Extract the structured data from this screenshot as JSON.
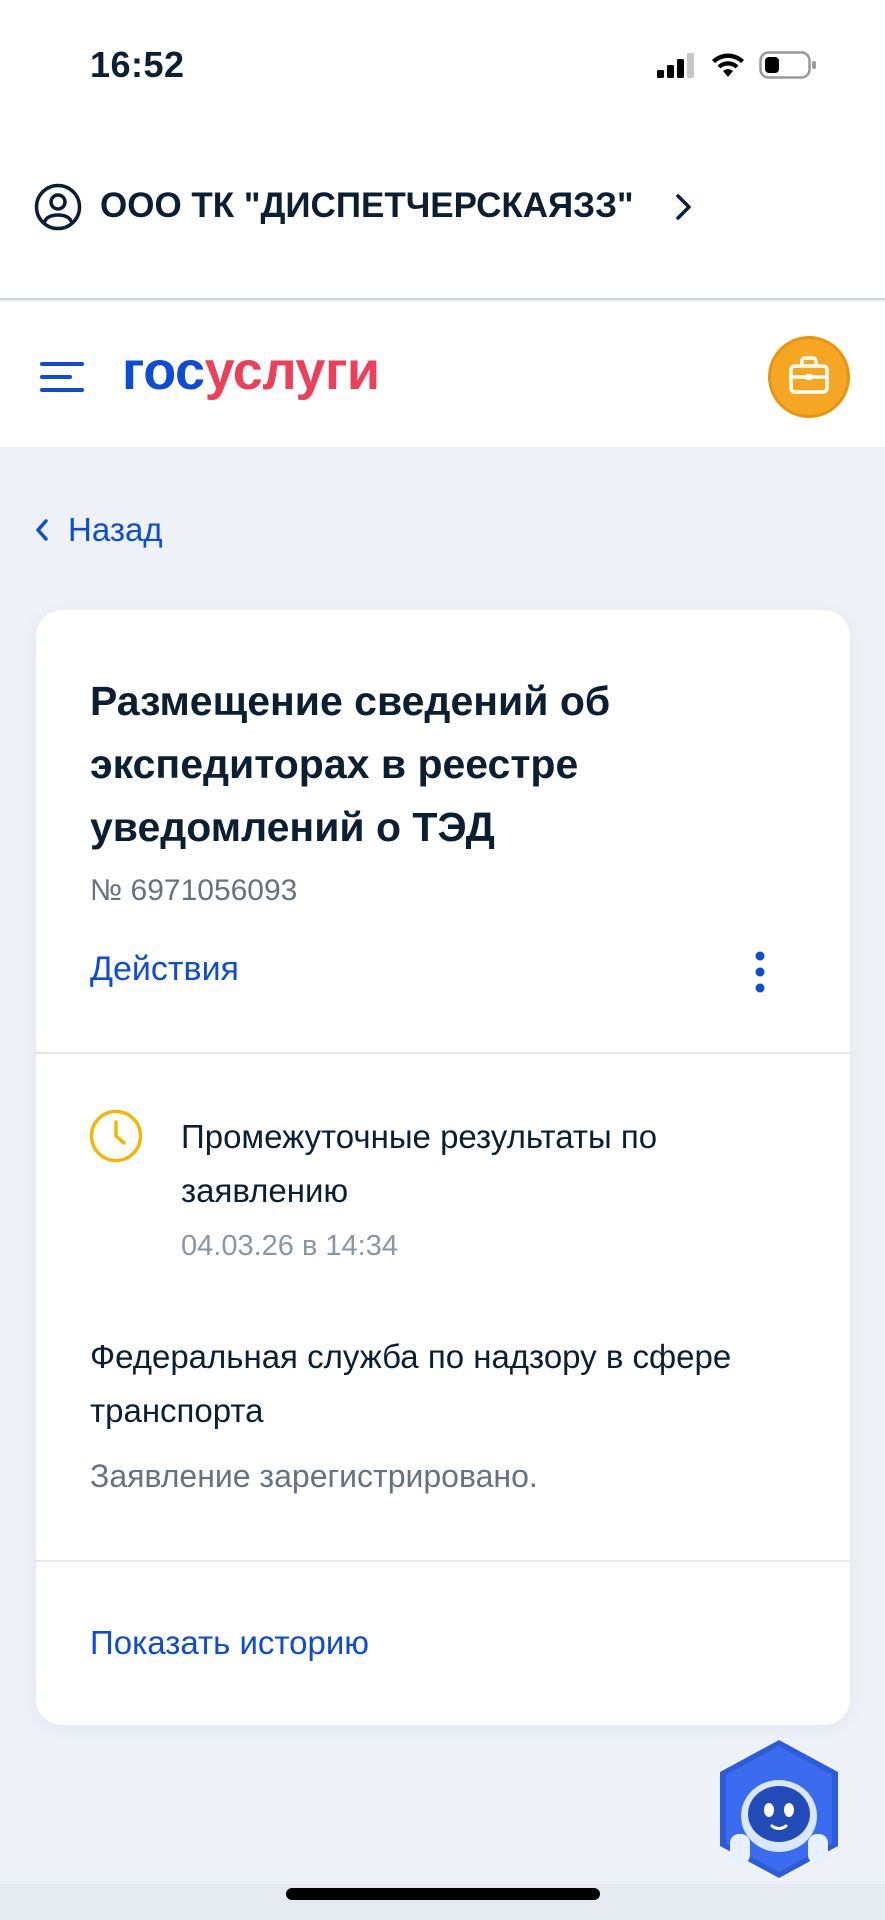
{
  "status_bar": {
    "time": "16:52",
    "icons": [
      "cellular-signal-icon",
      "wifi-icon",
      "battery-icon"
    ]
  },
  "account": {
    "name": "ООО ТК \"ДИСПЕТЧЕРСКАЯЗЗ\"",
    "icon": "user-circle-icon",
    "chevron": "chevron-right-icon"
  },
  "header": {
    "logo_part1": "гос",
    "logo_part2": "услуги",
    "menu_icon": "hamburger-menu-icon",
    "briefcase_icon": "briefcase-icon"
  },
  "nav": {
    "back_label": "Назад"
  },
  "application": {
    "title": "Размещение сведений об экспедиторах в реестре уведомлений о ТЭД",
    "number": "№ 6971056093",
    "actions_label": "Действия",
    "status": {
      "text": "Промежуточные результаты по заявлению",
      "date": "04.03.26 в 14:34"
    },
    "agency": "Федеральная служба по надзору в сфере транспорта",
    "agency_note": "Заявление зарегистрировано.",
    "history_label": "Показать историю"
  },
  "colors": {
    "brand_blue": "#0d4cd3",
    "brand_red": "#ee3f58",
    "accent_orange": "#f5a623",
    "clock_yellow": "#f2b705",
    "page_bg": "#eef2f8"
  }
}
